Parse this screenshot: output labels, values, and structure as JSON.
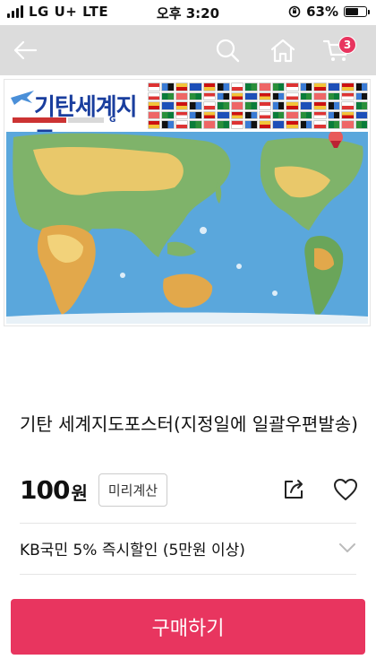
{
  "status_bar": {
    "carrier": "LG U+ LTE",
    "time": "오후 3:20",
    "battery": "63%",
    "battery_level": 0.63
  },
  "header": {
    "back_icon": "arrow-left-icon",
    "search_icon": "search-icon",
    "home_icon": "home-icon",
    "cart_icon": "cart-icon",
    "cart_count": "3"
  },
  "product": {
    "image_title": "기탄세계지도",
    "title": "기탄 세계지도포스터(지정일에 일괄우편발송)",
    "price": "100",
    "price_unit": "원",
    "calc_label": "미리계산",
    "promo": "KB국민 5% 즉시할인 (5만원 이상)",
    "buy_label": "구매하기"
  },
  "colors": {
    "accent": "#e8355f",
    "header_bg": "#dcdcdc"
  }
}
